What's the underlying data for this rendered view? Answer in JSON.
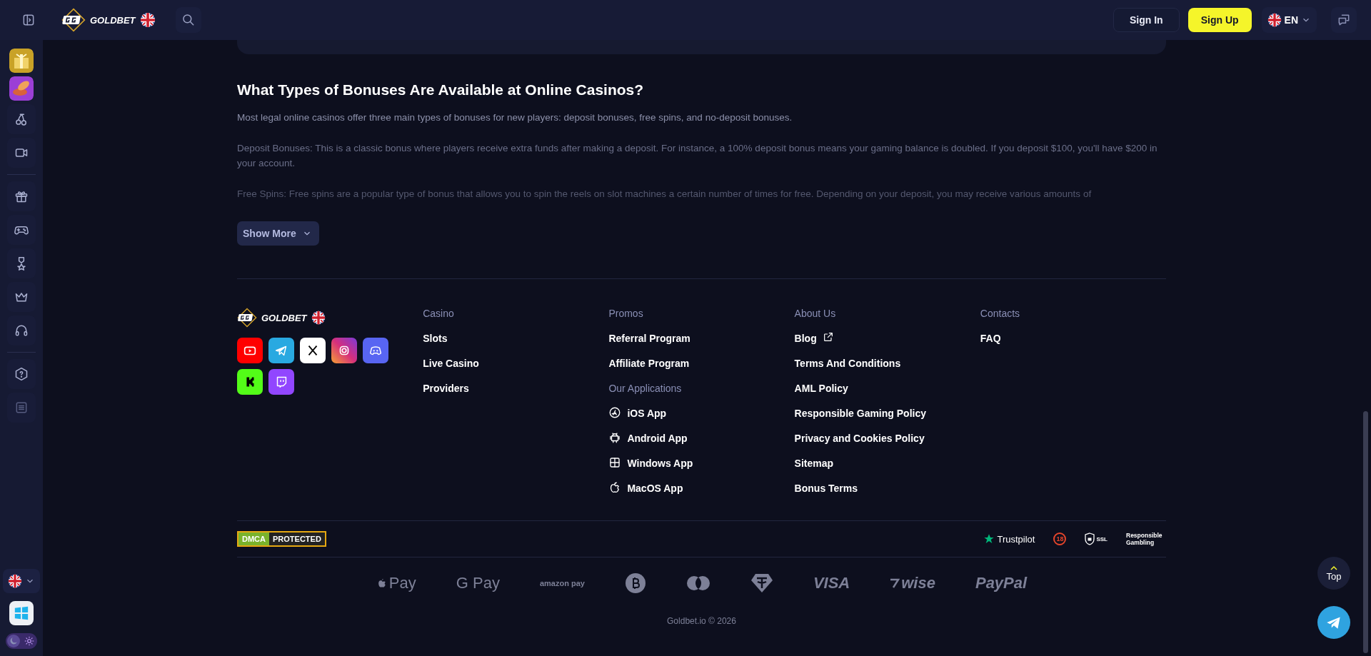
{
  "header": {
    "brand": "GOLDBET",
    "sign_in": "Sign In",
    "sign_up": "Sign Up",
    "language": "EN"
  },
  "sidebar": {
    "items": [
      {
        "kind": "gift-tile"
      },
      {
        "kind": "coin-tile"
      },
      {
        "kind": "cherries"
      },
      {
        "kind": "video"
      },
      {
        "kind": "divider"
      },
      {
        "kind": "gift"
      },
      {
        "kind": "gamepad"
      },
      {
        "kind": "medal"
      },
      {
        "kind": "crown"
      },
      {
        "kind": "headset"
      },
      {
        "kind": "divider"
      },
      {
        "kind": "help"
      },
      {
        "kind": "list"
      }
    ]
  },
  "article": {
    "title": "What Types of Bonuses Are Available at Online Casinos?",
    "paragraphs": [
      "Most legal online casinos offer three main types of bonuses for new players: deposit bonuses, free spins, and no-deposit bonuses.",
      "Deposit Bonuses: This is a classic bonus where players receive extra funds after making a deposit. For instance, a 100% deposit bonus means your gaming balance is doubled. If you deposit $100, you'll have $200 in your account.",
      "Free Spins: Free spins are a popular type of bonus that allows you to spin the reels on slot machines a certain number of times for free. Depending on your deposit, you may receive various amounts of"
    ],
    "show_more": "Show More"
  },
  "footer": {
    "brand": "GOLDBET",
    "socials": [
      {
        "kind": "youtube"
      },
      {
        "kind": "telegram"
      },
      {
        "kind": "x"
      },
      {
        "kind": "instagram"
      },
      {
        "kind": "discord"
      },
      {
        "kind": "kick"
      },
      {
        "kind": "twitch"
      }
    ],
    "columns": [
      {
        "sections": [
          {
            "heading": "Casino",
            "links": [
              {
                "label": "Slots"
              },
              {
                "label": "Live Casino"
              },
              {
                "label": "Providers"
              }
            ]
          }
        ]
      },
      {
        "sections": [
          {
            "heading": "Promos",
            "links": [
              {
                "label": "Referral Program"
              },
              {
                "label": "Affiliate Program"
              }
            ]
          },
          {
            "heading": "Our Applications",
            "links": [
              {
                "label": "iOS App",
                "kind": "appstore"
              },
              {
                "label": "Android App",
                "kind": "android"
              },
              {
                "label": "Windows App",
                "kind": "windows"
              },
              {
                "label": "MacOS App",
                "kind": "apple"
              }
            ]
          }
        ]
      },
      {
        "sections": [
          {
            "heading": "About Us",
            "links": [
              {
                "label": "Blog",
                "external": true
              },
              {
                "label": "Terms And Conditions",
                "external": false
              },
              {
                "label": "AML Policy",
                "external": false
              },
              {
                "label": "Responsible Gaming Policy",
                "external": false
              },
              {
                "label": "Privacy and Cookies Policy",
                "external": false
              },
              {
                "label": "Sitemap",
                "external": false
              },
              {
                "label": "Bonus Terms",
                "external": false
              }
            ]
          }
        ]
      },
      {
        "sections": [
          {
            "heading": "Contacts",
            "links": [
              {
                "label": "FAQ"
              }
            ]
          }
        ]
      }
    ],
    "dmca": [
      "DMCA",
      "PROTECTED"
    ],
    "trust_badges": [
      {
        "kind": "trustpilot",
        "label": "Trustpilot"
      },
      {
        "kind": "age",
        "label": "18"
      },
      {
        "kind": "ssl",
        "label": "SSL"
      },
      {
        "kind": "responsible",
        "label": "Responsible Gambling"
      }
    ],
    "payments": [
      {
        "kind": "apple",
        "label": "Pay"
      },
      {
        "kind": "text",
        "label": "G Pay"
      },
      {
        "kind": "small",
        "label": "amazon pay"
      },
      {
        "kind": "bitcoin"
      },
      {
        "kind": "mastercard"
      },
      {
        "kind": "tether"
      },
      {
        "kind": "italic",
        "label": "VISA"
      },
      {
        "kind": "wise",
        "label": "wise"
      },
      {
        "kind": "italic",
        "label": "PayPal"
      }
    ],
    "copyright": "Goldbet.io © 2026"
  },
  "scroll_top": "Top",
  "theme": {
    "dark": true
  }
}
